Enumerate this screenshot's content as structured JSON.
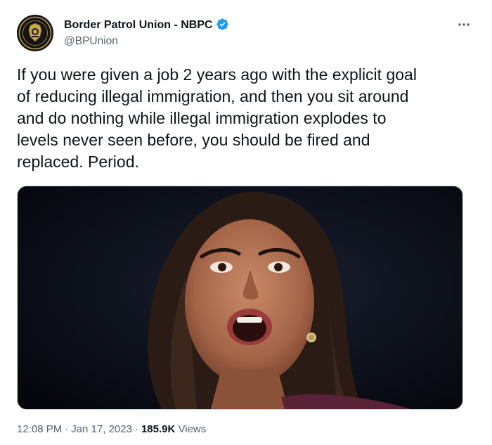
{
  "author": {
    "display_name": "Border Patrol Union - NBPC",
    "handle": "@BPUnion",
    "verified": true,
    "avatar_icon": "border-patrol-badge-logo"
  },
  "tweet": {
    "text": "If you were given a job 2 years ago with the explicit goal\nof reducing illegal immigration, and then you sit around\nand do nothing while illegal immigration explodes to\nlevels never seen before, you should be fired and\nreplaced. Period.",
    "media": {
      "kind": "photo"
    }
  },
  "meta": {
    "time": "12:08 PM",
    "separator": "·",
    "date": "Jan 17, 2023",
    "views_count": "185.9K",
    "views_label": "Views"
  },
  "colors": {
    "text_primary": "#0f1419",
    "text_secondary": "#536471",
    "verified_blue": "#1d9bf0",
    "border": "#cfd9de"
  },
  "icons": {
    "more": "more-horizontal-icon",
    "verified": "verified-badge-icon"
  }
}
